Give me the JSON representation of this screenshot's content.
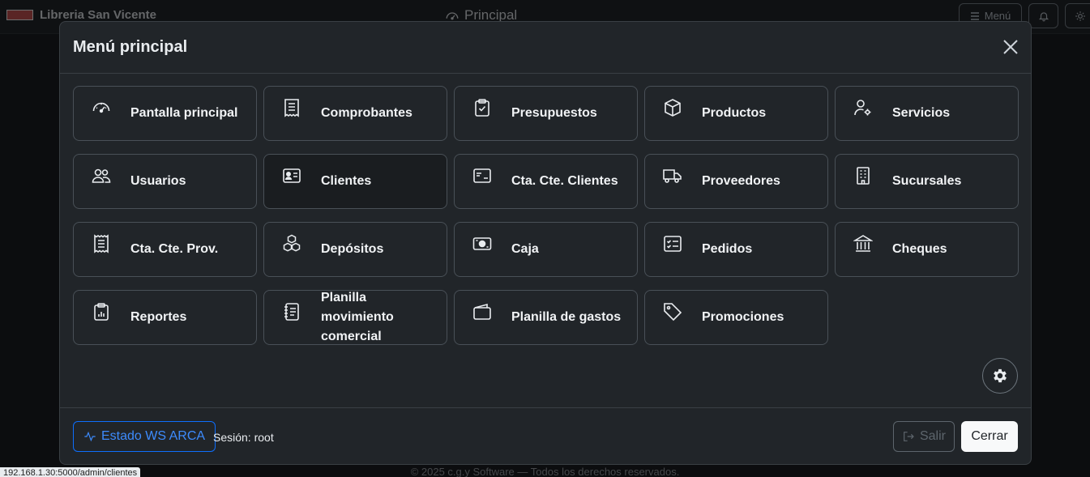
{
  "navbar": {
    "brand": "Libreria San Vicente",
    "center_title": "Principal",
    "menu_label": "Menú"
  },
  "modal": {
    "title": "Menú principal",
    "tiles": [
      {
        "label": "Pantalla principal",
        "icon": "speedometer-icon"
      },
      {
        "label": "Comprobantes",
        "icon": "receipt-icon"
      },
      {
        "label": "Presupuestos",
        "icon": "clipboard-check-icon"
      },
      {
        "label": "Productos",
        "icon": "box-icon"
      },
      {
        "label": "Servicios",
        "icon": "person-gear-icon"
      },
      {
        "label": "Usuarios",
        "icon": "people-icon"
      },
      {
        "label": "Clientes",
        "icon": "person-vcard-icon"
      },
      {
        "label": "Cta. Cte. Clientes",
        "icon": "credit-card-icon"
      },
      {
        "label": "Proveedores",
        "icon": "truck-icon"
      },
      {
        "label": "Sucursales",
        "icon": "building-icon"
      },
      {
        "label": "Cta. Cte. Prov.",
        "icon": "receipt-cutoff-icon"
      },
      {
        "label": "Depósitos",
        "icon": "boxes-icon"
      },
      {
        "label": "Caja",
        "icon": "cash-icon"
      },
      {
        "label": "Pedidos",
        "icon": "card-checklist-icon"
      },
      {
        "label": "Cheques",
        "icon": "bank-icon"
      },
      {
        "label": "Reportes",
        "icon": "clipboard-data-icon"
      },
      {
        "label": "Planilla movimiento comercial",
        "icon": "journal-text-icon"
      },
      {
        "label": "Planilla de gastos",
        "icon": "wallet-icon"
      },
      {
        "label": "Promociones",
        "icon": "tag-icon"
      }
    ],
    "footer": {
      "ws_button": "Estado WS ARCA",
      "session": "Sesión: root",
      "salir": "Salir",
      "cerrar": "Cerrar"
    }
  },
  "page_footer": "© 2025 c.g.y Software — Todos los derechos reservados.",
  "status_url": "192.168.1.30:5000/admin/clientes",
  "colors": {
    "primary": "#0d6efd",
    "modal_bg": "#212529",
    "tile_border": "#495057"
  }
}
